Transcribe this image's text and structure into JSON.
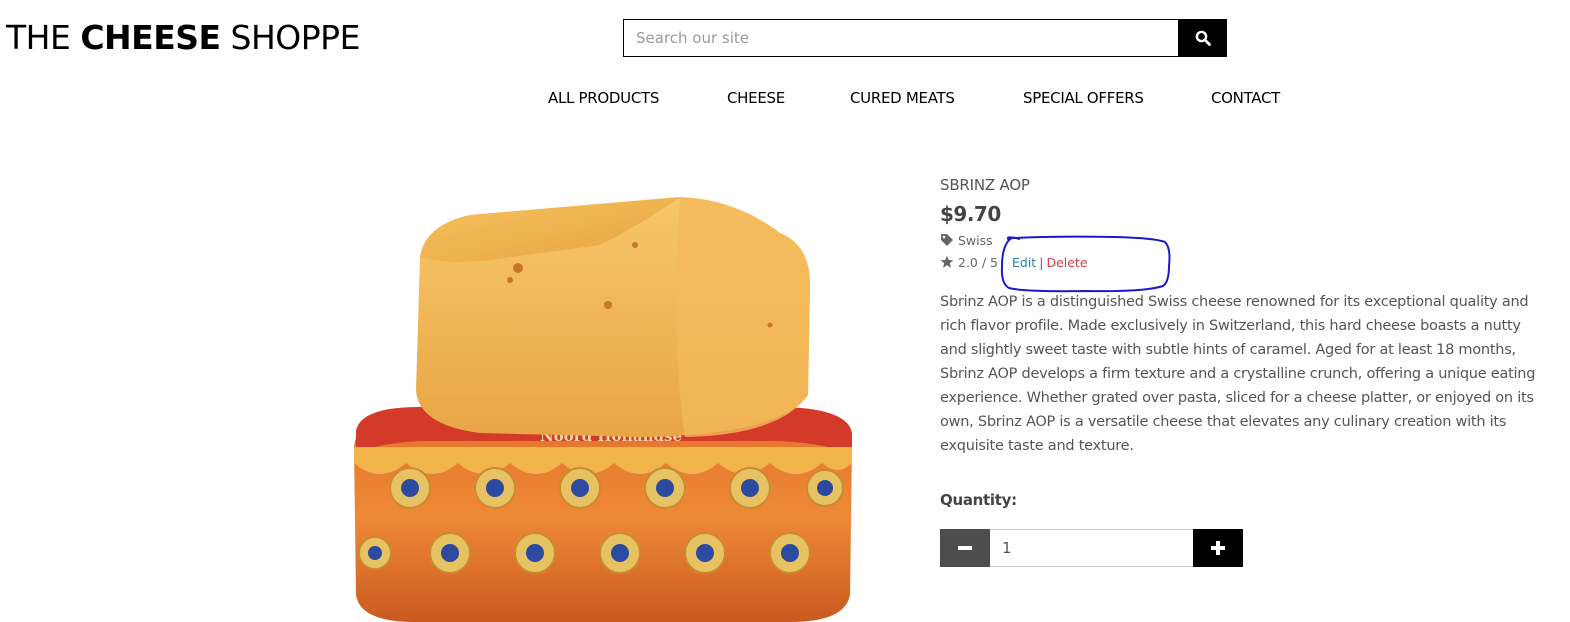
{
  "brand": {
    "prefix": "THE ",
    "bold": "CHEESE",
    "suffix": " SHOPPE"
  },
  "search": {
    "placeholder": "Search our site",
    "value": "",
    "icon": "search-icon"
  },
  "nav": [
    {
      "label": "ALL PRODUCTS"
    },
    {
      "label": "CHEESE"
    },
    {
      "label": "CURED MEATS"
    },
    {
      "label": "SPECIAL OFFERS"
    },
    {
      "label": "CONTACT"
    }
  ],
  "product": {
    "name": "SBRINZ AOP",
    "price": "$9.70",
    "category": "Swiss",
    "category_icon": "tag-icon",
    "rating": "2.0 / 5",
    "rating_icon": "star-icon",
    "edit_label": "Edit",
    "separator": "|",
    "delete_label": "Delete",
    "description": "Sbrinz AOP is a distinguished Swiss cheese renowned for its exceptional quality and rich flavor profile. Made exclusively in Switzerland, this hard cheese boasts a nutty and slightly sweet taste with subtle hints of caramel. Aged for at least 18 months, Sbrinz AOP develops a firm texture and a crystalline crunch, offering a unique eating experience. Whether grated over pasta, sliced for a cheese platter, or enjoyed on its own, Sbrinz AOP is a versatile cheese that elevates any culinary creation with its exquisite taste and texture.",
    "image_label": "Noord Hollandse"
  },
  "quantity": {
    "label": "Quantity:",
    "value": "1"
  },
  "colors": {
    "edit_link": "#2a7ab8",
    "delete_link": "#d0414a",
    "annotation": "#1a1acc",
    "minus_button": "#4d4d4d",
    "plus_button": "#000000"
  }
}
